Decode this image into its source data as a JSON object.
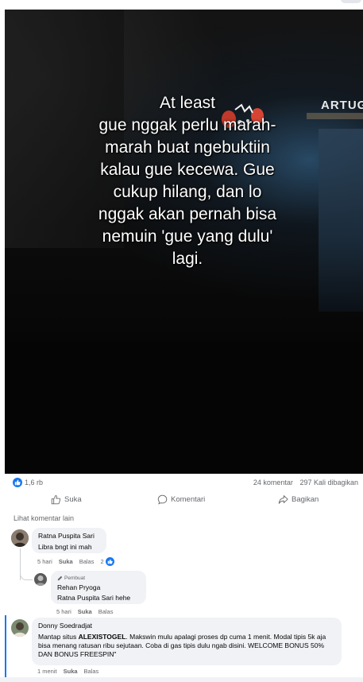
{
  "media": {
    "caption_lines": [
      "At least",
      "gue nggak perlu marah-",
      "marah buat ngebuktiin",
      "kalau gue kecewa. Gue",
      "cukup hilang, dan lo",
      "nggak akan pernah bisa",
      "nemuin 'gue yang dulu'",
      "lagi."
    ],
    "sign_text": "ARTUG"
  },
  "stats": {
    "likes": "1,6 rb",
    "comments": "24 komentar",
    "shares": "297 Kali dibagikan"
  },
  "actions": {
    "like": "Suka",
    "comment": "Komentari",
    "share": "Bagikan"
  },
  "more_comments": "Lihat komentar lain",
  "comments": [
    {
      "name": "Ratna Puspita Sari",
      "text": "Libra bngt ini mah",
      "time": "5 hari",
      "like": "Suka",
      "reply": "Balas",
      "reactions": "2",
      "reply_item": {
        "badge": "Pembuat",
        "name": "Rehan Pryoga",
        "mention": "Ratna Puspita Sari",
        "text": " hehe",
        "time": "5 hari",
        "like": "Suka",
        "reply": "Balas"
      }
    },
    {
      "name": "Donny Soedradjat",
      "text_pre": "Mantap situs ",
      "text_bold": "ALEXISTOGEL",
      "text_post": ". Makswin mulu apalagi proses dp cuma 1 menit. Modal tipis 5k aja bisa menang ratusan ribu sejutaan. Coba di gas tipis dulu ngab disini. WELCOME BONUS 50% DAN BONUS FREESPIN\"",
      "time": "1 menit",
      "like": "Suka",
      "reply": "Balas"
    }
  ],
  "colors": {
    "accent": "#1877f2",
    "muted_text": "#65676b",
    "bubble_bg": "#f0f2f5"
  }
}
